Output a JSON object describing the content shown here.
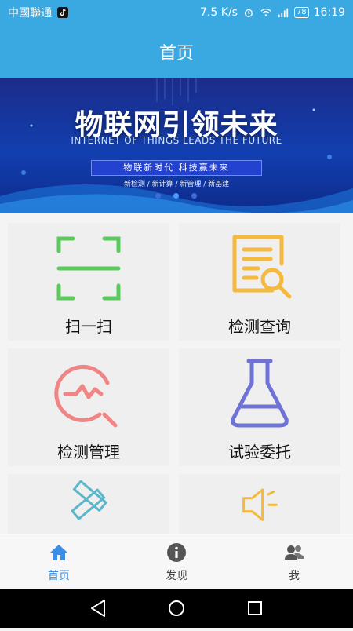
{
  "status_bar": {
    "carrier": "中國聯通",
    "speed": "7.5 K/s",
    "battery": "78",
    "time": "16:19",
    "icons": [
      "tiktok-icon",
      "alarm-icon",
      "wifi-icon",
      "signal-icon",
      "battery-icon"
    ]
  },
  "header": {
    "title": "首页"
  },
  "banner": {
    "headline": "物联网引领未来",
    "subline": "INTERNET OF THINGS LEADS THE FUTURE",
    "slogan": "物联新时代 科技赢未来",
    "tags": "新检测 / 新计算 / 新管理 / 新基建",
    "pager": {
      "count": 3,
      "active_index": 1
    }
  },
  "grid": {
    "items": [
      {
        "label": "扫一扫",
        "icon": "scan-icon",
        "color": "#5cc95c"
      },
      {
        "label": "检测查询",
        "icon": "document-search-icon",
        "color": "#f5b93f"
      },
      {
        "label": "检测管理",
        "icon": "chart-search-icon",
        "color": "#f08585"
      },
      {
        "label": "试验委托",
        "icon": "flask-icon",
        "color": "#6f73d6"
      },
      {
        "label": "",
        "icon": "ruler-pencil-icon",
        "color": "#5bb6c9"
      },
      {
        "label": "",
        "icon": "speaker-icon",
        "color": "#f5b93f"
      }
    ]
  },
  "tab_bar": {
    "items": [
      {
        "label": "首页",
        "icon": "home-icon",
        "active": true
      },
      {
        "label": "发现",
        "icon": "info-icon",
        "active": false
      },
      {
        "label": "我",
        "icon": "users-icon",
        "active": false
      }
    ],
    "active_color": "#3a8ee6"
  },
  "colors": {
    "header": "#3aa8e1",
    "banner_dark": "#1b2c8a",
    "banner_light": "#123fb0"
  }
}
